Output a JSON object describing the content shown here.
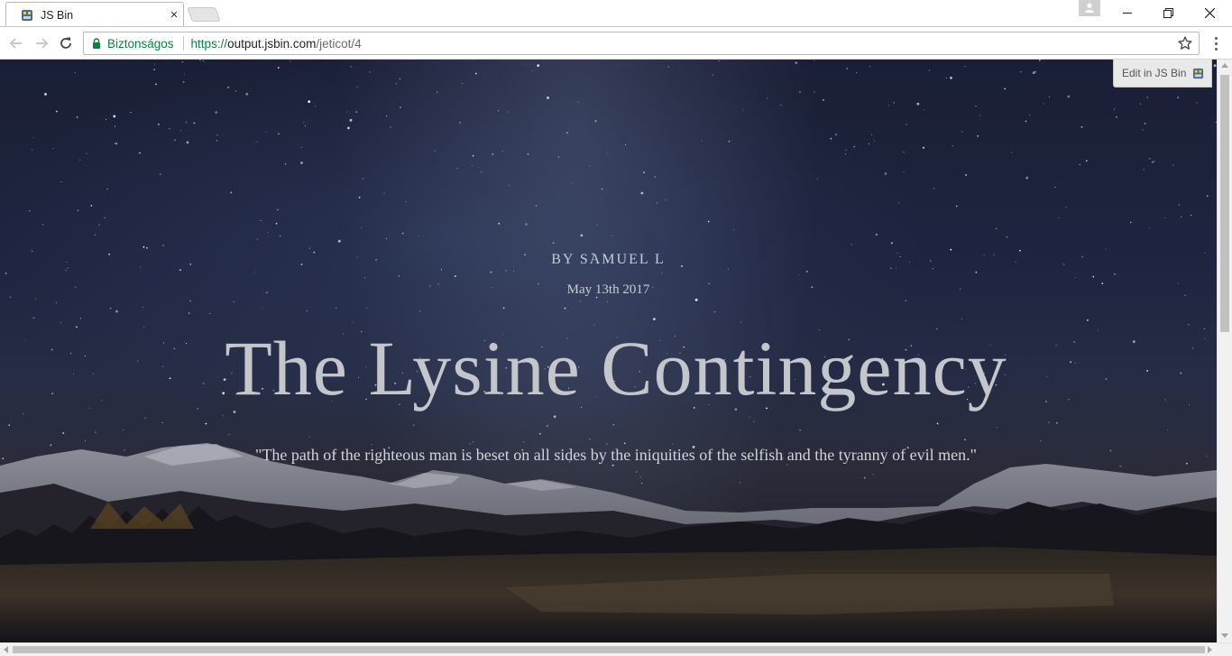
{
  "browser": {
    "tab": {
      "title": "JS Bin",
      "close_glyph": "×",
      "favicon": "jsbin-icon"
    },
    "window_controls": {
      "minimize": "—",
      "maximize": "❐",
      "close": "✕"
    },
    "omnibox": {
      "security_label": "Biztonságos",
      "url_scheme": "https://",
      "url_host": "output.jsbin.com",
      "url_path": "/jeticot/4"
    },
    "colors": {
      "secure_green": "#0b8043"
    }
  },
  "page": {
    "edit_button_label": "Edit in JS Bin",
    "byline": "BY SAMUEL L",
    "date": "May 13th 2017",
    "headline": "The Lysine Contingency",
    "quote": "\"The path of the righteous man is beset on all sides by the iniquities of the selfish and the tyranny of evil men.\"",
    "background": "night-sky-mountains-photo"
  }
}
